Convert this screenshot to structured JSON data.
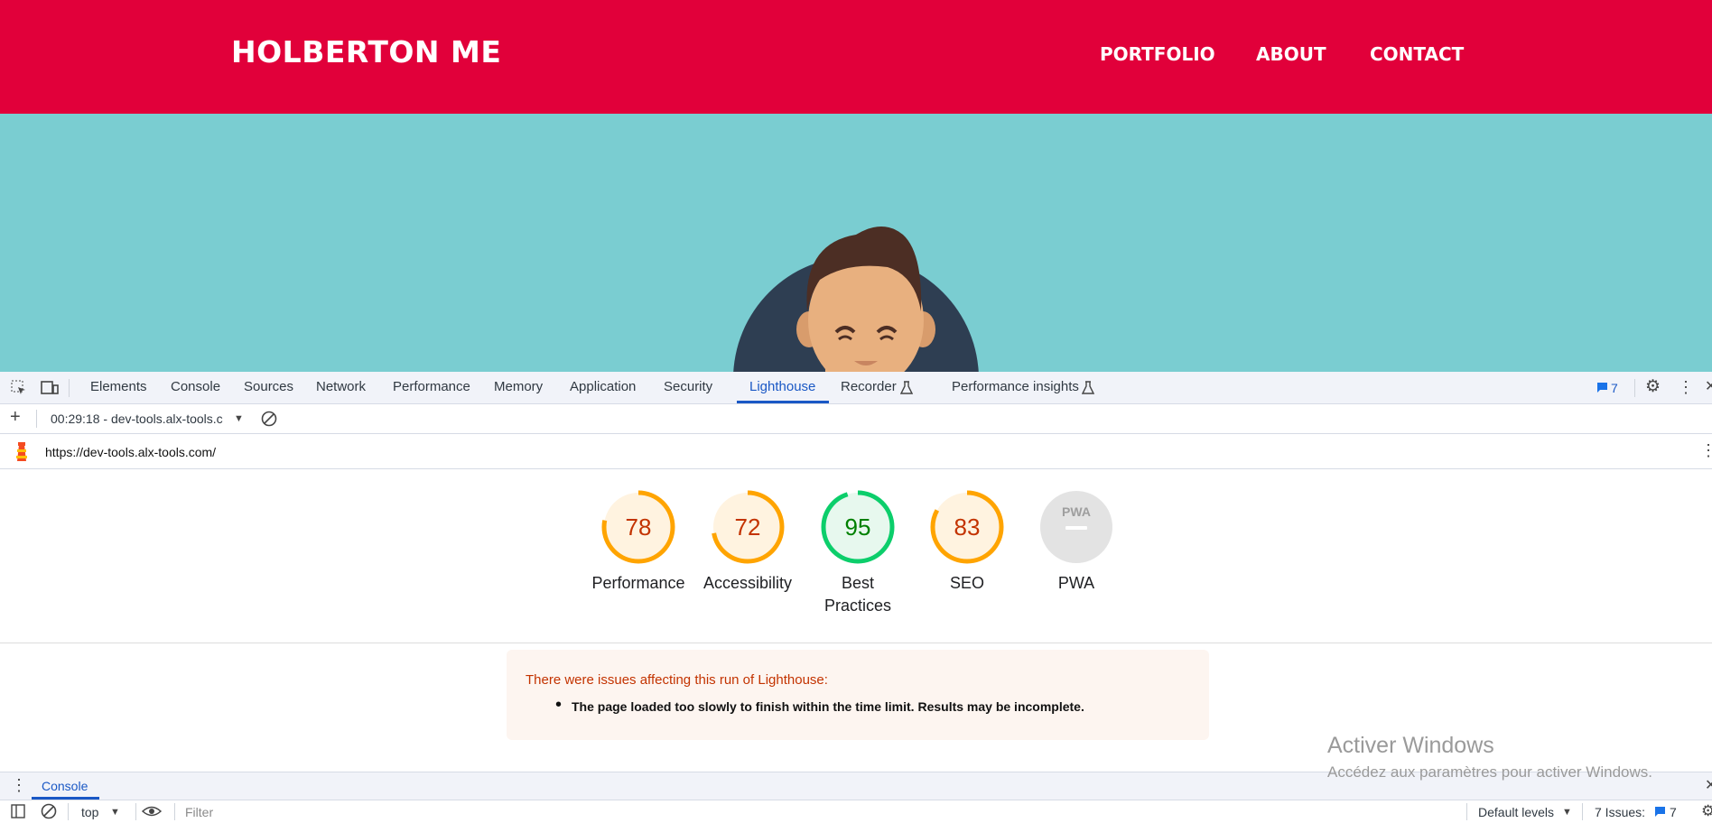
{
  "site": {
    "brand": "HOLBERTON ME",
    "nav": [
      "PORTFOLIO",
      "ABOUT",
      "CONTACT"
    ],
    "colors": {
      "header": "#e1003a",
      "hero": "#7acdd1"
    }
  },
  "devtools": {
    "tabs": [
      "Elements",
      "Console",
      "Sources",
      "Network",
      "Performance",
      "Memory",
      "Application",
      "Security",
      "Lighthouse",
      "Recorder",
      "Performance insights"
    ],
    "active_tab": "Lighthouse",
    "issues_badge": "7",
    "report_select": "00:29:18 - dev-tools.alx-tools.c",
    "url": "https://dev-tools.alx-tools.com/",
    "scores": [
      {
        "value": "78",
        "label": "Performance",
        "fraction": 0.78,
        "color": "#ffa400",
        "text": "#c33300",
        "bg": "#fff3e0"
      },
      {
        "value": "72",
        "label": "Accessibility",
        "fraction": 0.72,
        "color": "#ffa400",
        "text": "#c33300",
        "bg": "#fff3e0"
      },
      {
        "value": "95",
        "label": "Best Practices",
        "fraction": 0.95,
        "color": "#0cce6b",
        "text": "#008000",
        "bg": "#e7f8ee"
      },
      {
        "value": "83",
        "label": "SEO",
        "fraction": 0.83,
        "color": "#ffa400",
        "text": "#c33300",
        "bg": "#fff3e0"
      }
    ],
    "pwa": {
      "label": "PWA",
      "badge": "PWA"
    },
    "warning": {
      "title": "There were issues affecting this run of Lighthouse:",
      "item": "The page loaded too slowly to finish within the time limit. Results may be incomplete."
    },
    "drawer_tab": "Console",
    "console": {
      "context": "top",
      "filter_placeholder": "Filter",
      "levels": "Default levels",
      "issues_label": "7 Issues:",
      "issues_count": "7"
    }
  },
  "watermark": {
    "title": "Activer Windows",
    "subtitle": "Accédez aux paramètres pour activer Windows."
  }
}
